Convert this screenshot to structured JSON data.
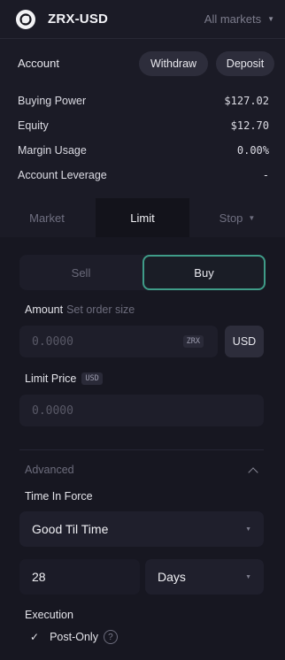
{
  "header": {
    "pair": "ZRX-USD",
    "markets_label": "All markets",
    "logo_icon": "zrx-logo-icon"
  },
  "account": {
    "title": "Account",
    "withdraw_label": "Withdraw",
    "deposit_label": "Deposit",
    "rows": [
      {
        "label": "Buying Power",
        "value": "$127.02"
      },
      {
        "label": "Equity",
        "value": "$12.70"
      },
      {
        "label": "Margin Usage",
        "value": "0.00%"
      },
      {
        "label": "Account Leverage",
        "value": "-"
      }
    ]
  },
  "order_tabs": {
    "market": "Market",
    "limit": "Limit",
    "stop": "Stop",
    "active": "Limit"
  },
  "side": {
    "sell": "Sell",
    "buy": "Buy",
    "active": "Buy",
    "accent": "#3f9c88"
  },
  "amount": {
    "label": "Amount",
    "hint": "Set order size",
    "placeholder": "0.0000",
    "asset_badge": "ZRX",
    "currency_button": "USD"
  },
  "limit_price": {
    "label": "Limit Price",
    "badge": "USD",
    "placeholder": "0.0000"
  },
  "advanced": {
    "label": "Advanced",
    "expanded": true
  },
  "time_in_force": {
    "label": "Time In Force",
    "value": "Good Til Time",
    "duration_value": "28",
    "duration_unit": "Days"
  },
  "execution": {
    "label": "Execution",
    "post_only_label": "Post-Only",
    "post_only_checked": true
  }
}
